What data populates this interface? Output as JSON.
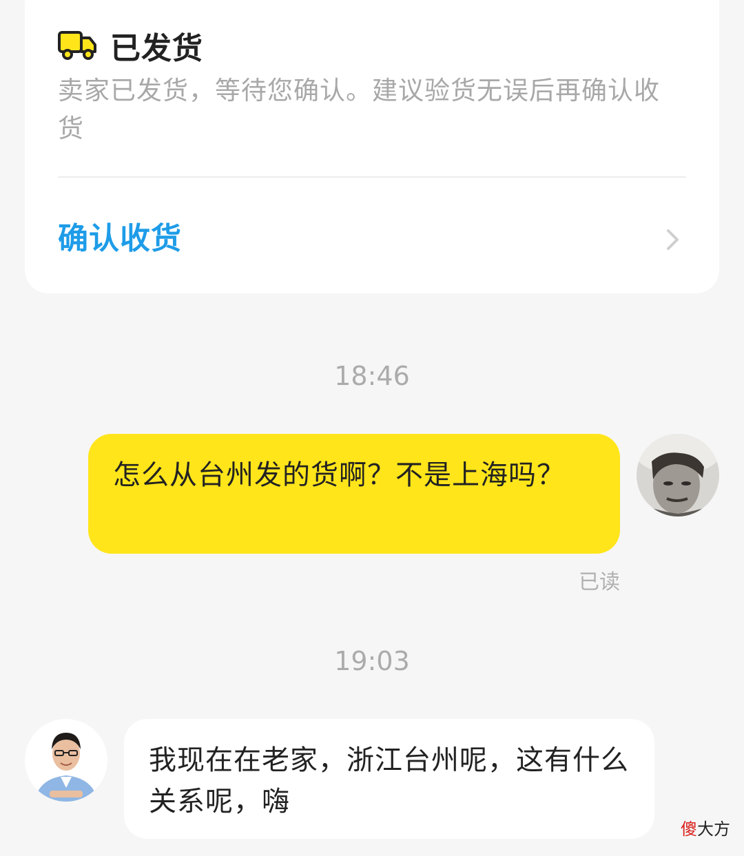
{
  "order_card": {
    "status_icon": "truck-icon",
    "status_title": "已发货",
    "status_description": "卖家已发货，等待您确认。建议验货无误后再确认收货",
    "confirm_label": "确认收货",
    "confirm_icon": "chevron-right-icon"
  },
  "messages": [
    {
      "time": "18:46",
      "direction": "outgoing",
      "text": "怎么从台州发的货啊？不是上海吗？",
      "read_status": "已读",
      "bubble_color": "#ffe51a"
    },
    {
      "time": "19:03",
      "direction": "incoming",
      "text": "我现在在老家，浙江台州呢，这有什么关系呢，嗨",
      "bubble_color": "#ffffff"
    }
  ],
  "watermark": {
    "first_char": "傻",
    "rest": "大方"
  },
  "colors": {
    "accent_blue": "#1e9ce8",
    "accent_yellow": "#ffe51a",
    "background": "#f6f6f6"
  }
}
